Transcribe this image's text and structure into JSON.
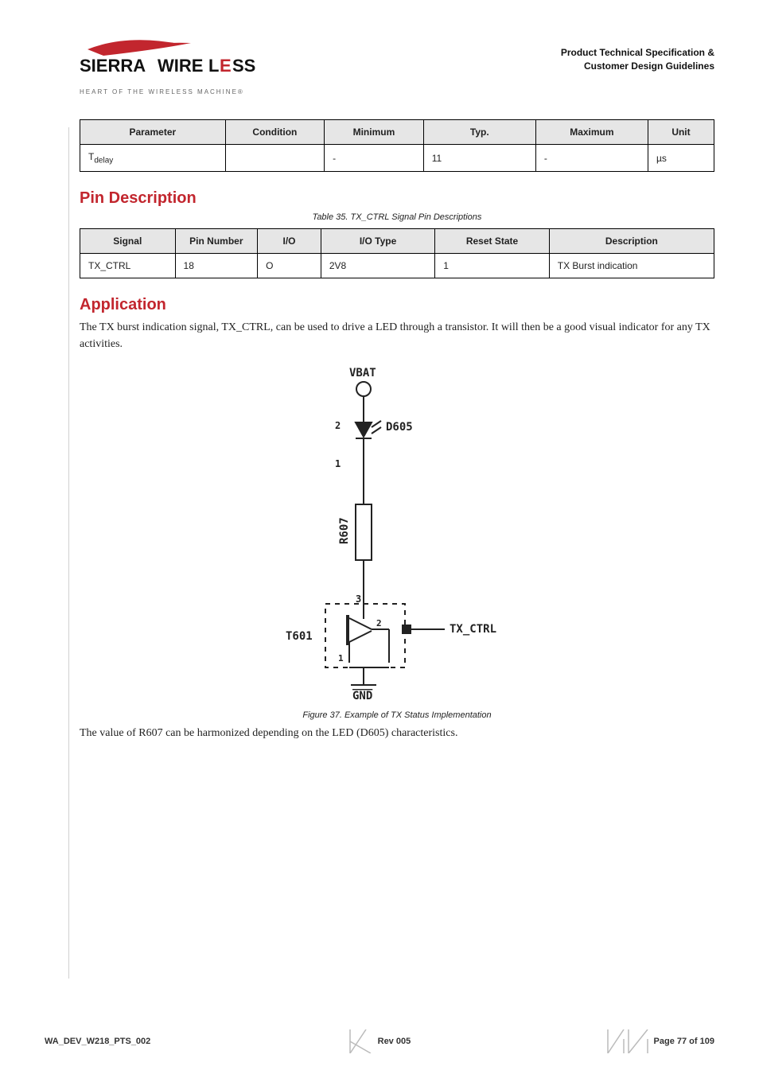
{
  "header": {
    "title_line1": "Product Technical Specification &",
    "title_line2": "Customer Design Guidelines",
    "logo_main": "SIERRA WIRELESS",
    "logo_tag": "HEART OF THE WIRELESS MACHINE®"
  },
  "table1": {
    "headers": [
      "Parameter",
      "Condition",
      "Minimum",
      "Typ.",
      "Maximum",
      "Unit"
    ],
    "rows": [
      [
        "T",
        "delay",
        "",
        "-",
        "11",
        "-",
        "µs"
      ]
    ]
  },
  "section1": {
    "title": "Pin Description",
    "caption": "Table 35.    TX_CTRL Signal Pin Descriptions"
  },
  "table2": {
    "headers": [
      "Signal",
      "Pin Number",
      "I/O",
      "I/O Type",
      "Reset State",
      "Description"
    ],
    "rows": [
      [
        "TX_CTRL",
        "18",
        "O",
        "2V8",
        "1",
        "TX Burst indication"
      ]
    ]
  },
  "section2": {
    "title": "Application",
    "para": "The TX burst indication signal, TX_CTRL, can be used to drive a LED through a transistor.  It will then be a good visual indicator for any TX activities.",
    "fig_caption": "Figure 37. Example of TX Status Implementation",
    "para2": "The value of R607 can be harmonized depending on the LED (D605) characteristics."
  },
  "diagram_labels": {
    "vbat": "VBAT",
    "d605": "D605",
    "r607": "R607",
    "t601": "T601",
    "txctrl": "TX_CTRL",
    "gnd": "GND",
    "n1": "1",
    "n2": "2",
    "n3": "3",
    "nn1": "1",
    "nn2": "2"
  },
  "footer": {
    "doc": "WA_DEV_W218_PTS_002",
    "rev": "Rev 005",
    "page": "Page 77 of 109"
  }
}
